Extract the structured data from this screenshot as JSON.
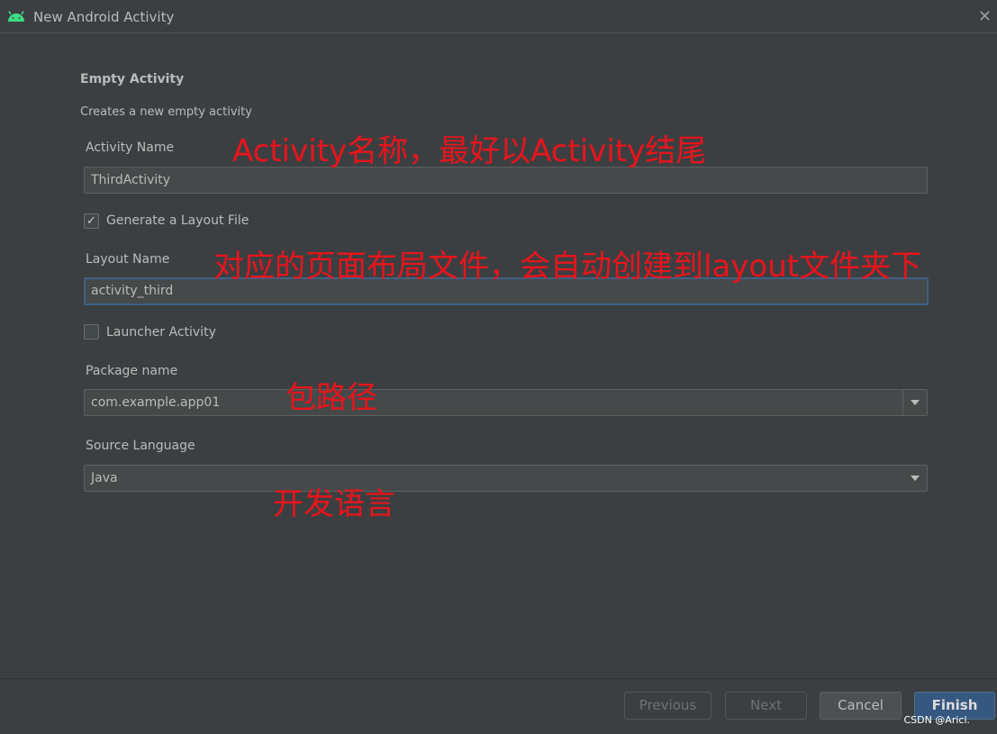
{
  "window": {
    "title": "New Android Activity",
    "icon": "android-icon"
  },
  "header": {
    "title": "Empty Activity",
    "subtitle": "Creates a new empty activity"
  },
  "form": {
    "activity_name": {
      "label": "Activity Name",
      "value": "ThirdActivity"
    },
    "generate_layout": {
      "label": "Generate a Layout File",
      "checked": true
    },
    "layout_name": {
      "label": "Layout Name",
      "value": "activity_third"
    },
    "launcher": {
      "label": "Launcher Activity",
      "checked": false
    },
    "package_name": {
      "label": "Package name",
      "value": "com.example.app01"
    },
    "source_language": {
      "label": "Source Language",
      "value": "Java"
    }
  },
  "annotations": {
    "activity": "Activity名称，最好以Activity结尾",
    "layout": "对应的页面布局文件，会自动创建到layout文件夹下",
    "package": "包路径",
    "language": "开发语言"
  },
  "buttons": {
    "previous": "Previous",
    "next": "Next",
    "cancel": "Cancel",
    "finish": "Finish"
  },
  "watermark": "CSDN @Aricl."
}
